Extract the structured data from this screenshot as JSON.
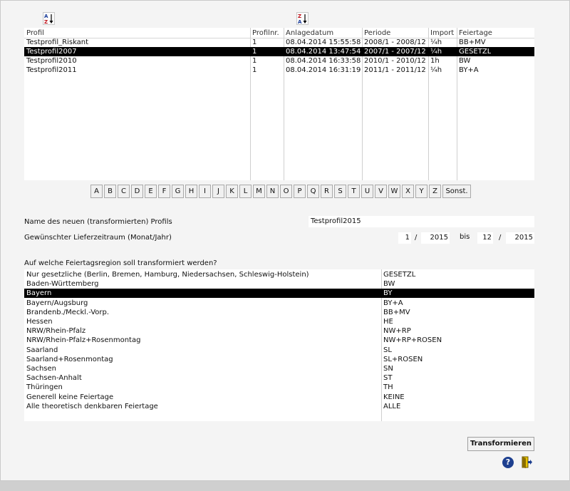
{
  "profile_table": {
    "headers": [
      "Profil",
      "Profilnr.",
      "Anlagedatum",
      "Periode",
      "Import",
      "Feiertage"
    ],
    "rows": [
      [
        "Testprofil_Riskant",
        "1",
        "08.04.2014 15:55:58",
        "2008/1 - 2008/12",
        "¼h",
        "BB+MV"
      ],
      [
        "Testprofil2007",
        "1",
        "08.04.2014 13:47:54",
        "2007/1 - 2007/12",
        "¼h",
        "GESETZL"
      ],
      [
        "Testprofil2010",
        "1",
        "08.04.2014 16:33:58",
        "2010/1 - 2010/12",
        "1h",
        "BW"
      ],
      [
        "Testprofil2011",
        "1",
        "08.04.2014 16:31:19",
        "2011/1 - 2011/12",
        "¼h",
        "BY+A"
      ]
    ],
    "selected_row": 1
  },
  "alphabet": [
    "A",
    "B",
    "C",
    "D",
    "E",
    "F",
    "G",
    "H",
    "I",
    "J",
    "K",
    "L",
    "M",
    "N",
    "O",
    "P",
    "Q",
    "R",
    "S",
    "T",
    "U",
    "V",
    "W",
    "X",
    "Y",
    "Z",
    "Sonst."
  ],
  "form": {
    "name_label": "Name des neuen (transformierten) Profils",
    "name_value": "Testprofil2015",
    "period_label": "Gewünschter Lieferzeitraum (Monat/Jahr)",
    "from_month": "1",
    "from_year": "2015",
    "separator": "/",
    "bis": "bis",
    "to_month": "12",
    "to_year": "2015"
  },
  "region_question": "Auf welche Feiertagsregion soll transformiert werden?",
  "regions": [
    [
      "Nur gesetzliche (Berlin, Bremen, Hamburg, Niedersachsen, Schleswig-Holstein)",
      "GESETZL"
    ],
    [
      "Baden-Württemberg",
      "BW"
    ],
    [
      "Bayern",
      "BY"
    ],
    [
      "Bayern/Augsburg",
      "BY+A"
    ],
    [
      "Brandenb./Meckl.-Vorp.",
      "BB+MV"
    ],
    [
      "Hessen",
      "HE"
    ],
    [
      "NRW/Rhein-Pfalz",
      "NW+RP"
    ],
    [
      "NRW/Rhein-Pfalz+Rosenmontag",
      "NW+RP+ROSEN"
    ],
    [
      "Saarland",
      "SL"
    ],
    [
      "Saarland+Rosenmontag",
      "SL+ROSEN"
    ],
    [
      "Sachsen",
      "SN"
    ],
    [
      "Sachsen-Anhalt",
      "ST"
    ],
    [
      "Thüringen",
      "TH"
    ],
    [
      "Generell keine Feiertage",
      "KEINE"
    ],
    [
      "Alle theoretisch denkbaren Feiertage",
      "ALLE"
    ]
  ],
  "selected_region": 2,
  "buttons": {
    "transform": "Transformieren",
    "help": "?"
  },
  "icons": [
    "sort-az-icon",
    "sort-za-icon",
    "help-icon",
    "exit-icon"
  ],
  "colors": {
    "selection": "#000000",
    "help_blue": "#1d3f8f",
    "exit_yellow": "#e8c400"
  }
}
